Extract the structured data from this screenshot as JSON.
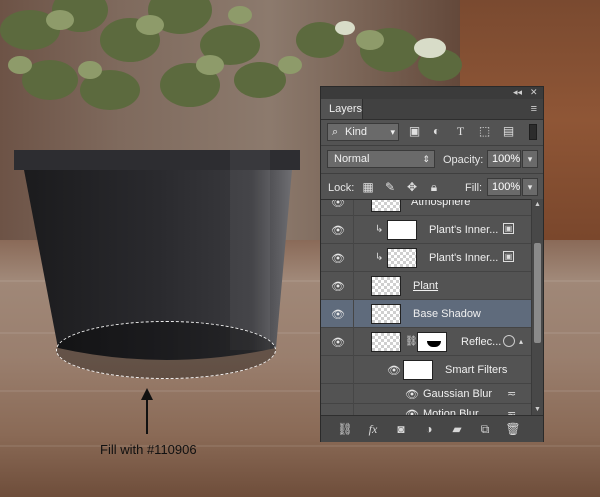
{
  "annotation": {
    "label": "Fill with #110906"
  },
  "colors": {
    "pot_fill": "#110906",
    "panel_bg": "#535353",
    "selected_row": "#5f6b7c"
  },
  "panel": {
    "title_tab": "Layers",
    "top_controls": {
      "collapse": "◂◂",
      "close": "✕"
    },
    "filter": {
      "kind_label": "Kind",
      "icons": [
        "image-filter-icon",
        "adjustment-filter-icon",
        "type-filter-icon",
        "shape-filter-icon",
        "smart-object-filter-icon"
      ]
    },
    "blend_mode": "Normal",
    "opacity_label": "Opacity:",
    "opacity_value": "100%",
    "lock_label": "Lock:",
    "fill_label": "Fill:",
    "fill_value": "100%",
    "layers": [
      {
        "name": "Atmosphere",
        "visible": true,
        "thumb": "checker"
      },
      {
        "name": "Plant's Inner...",
        "visible": true,
        "clipped": true,
        "thumb": "white"
      },
      {
        "name": "Plant's Inner...",
        "visible": true,
        "clipped": true,
        "thumb": "checker"
      },
      {
        "name": "Plant",
        "visible": true,
        "thumb": "checker",
        "smart": true
      },
      {
        "name": "Base Shadow",
        "visible": true,
        "thumb": "checker",
        "selected": true
      },
      {
        "name": "Reflec...",
        "visible": true,
        "thumb": "checker",
        "smart": true,
        "has_mask": true
      },
      {
        "name": "Smart Filters",
        "visible": true,
        "thumb": "white",
        "indent": true
      },
      {
        "name": "Gaussian Blur",
        "visible": true,
        "filter": true
      },
      {
        "name": "Motion Blur",
        "visible": true,
        "filter": true
      }
    ],
    "footer_icons": [
      "link-layers-icon",
      "fx-icon",
      "add-mask-icon",
      "adjustment-layer-icon",
      "group-folder-icon",
      "new-layer-icon",
      "trash-icon"
    ]
  }
}
